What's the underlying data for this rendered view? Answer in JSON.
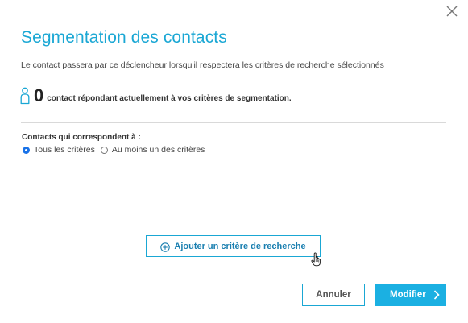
{
  "dialog": {
    "title": "Segmentation des contacts",
    "description": "Le contact passera par ce déclencheur lorsqu'il respectera les critères de recherche sélectionnés",
    "count": "0",
    "count_label": "contact répondant actuellement à vos critères de segmentation.",
    "criteria_heading": "Contacts qui correspondent à :",
    "match_options": [
      {
        "label": "Tous les critères",
        "checked": true
      },
      {
        "label": "Au moins un des critères",
        "checked": false
      }
    ],
    "add_criterion_label": "Ajouter un critère de recherche",
    "cancel_label": "Annuler",
    "submit_label": "Modifier"
  },
  "icons": {
    "close": "close-icon",
    "person": "person-icon",
    "plus": "plus-circle-icon",
    "cursor": "hand-cursor-icon",
    "chevron": "chevron-right-icon"
  },
  "colors": {
    "accent": "#1aa7d4",
    "submit_bg": "#1bb0e2",
    "radio_checked": "#1a73e8"
  }
}
